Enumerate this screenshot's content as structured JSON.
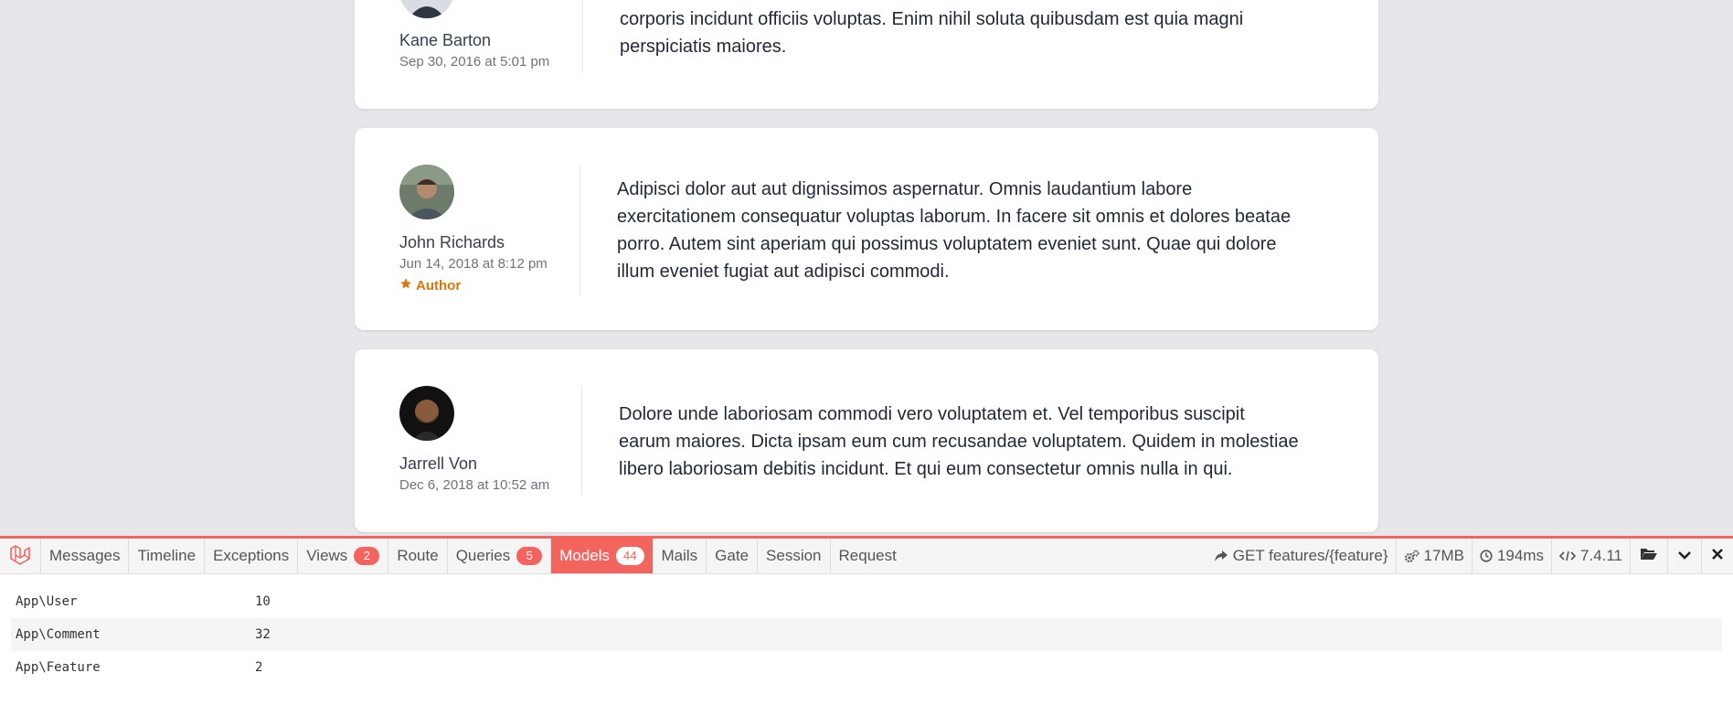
{
  "comments": [
    {
      "author": "Kane Barton",
      "date": "Sep 30, 2016 at 5:01 pm",
      "lines": [
        "corporis incidunt officiis voluptas. Enim nihil soluta quibusdam est quia magni",
        "perspiciatis maiores."
      ]
    },
    {
      "author": "John Richards",
      "date": "Jun 14, 2018 at 8:12 pm",
      "badge": "Author",
      "lines": [
        "Adipisci dolor aut aut dignissimos aspernatur. Omnis laudantium labore",
        "exercitationem consequatur voluptas laborum. In facere sit omnis et dolores beatae",
        "porro. Autem sint aperiam qui possimus voluptatem eveniet sunt. Quae qui dolore",
        "illum eveniet fugiat aut adipisci commodi."
      ]
    },
    {
      "author": "Jarrell Von",
      "date": "Dec 6, 2018 at 10:52 am",
      "lines": [
        "Dolore unde laboriosam commodi vero voluptatem et. Vel temporibus suscipit",
        "earum maiores. Dicta ipsam eum cum recusandae voluptatem. Quidem in molestiae",
        "libero laboriosam debitis incidunt. Et qui eum consectetur omnis nulla in qui."
      ]
    }
  ],
  "debugbar": {
    "accent_color": "#f4645f",
    "tabs": [
      {
        "label": "Messages"
      },
      {
        "label": "Timeline"
      },
      {
        "label": "Exceptions"
      },
      {
        "label": "Views",
        "count": "2"
      },
      {
        "label": "Route"
      },
      {
        "label": "Queries",
        "count": "5"
      },
      {
        "label": "Models",
        "count": "44",
        "active": true
      },
      {
        "label": "Mails"
      },
      {
        "label": "Gate"
      },
      {
        "label": "Session"
      },
      {
        "label": "Request"
      }
    ],
    "indicators": {
      "route": "GET features/{feature}",
      "memory": "17MB",
      "time": "194ms",
      "php_version": "7.4.11"
    },
    "models": [
      {
        "name": "App\\User",
        "count": "10"
      },
      {
        "name": "App\\Comment",
        "count": "32"
      },
      {
        "name": "App\\Feature",
        "count": "2"
      }
    ]
  }
}
